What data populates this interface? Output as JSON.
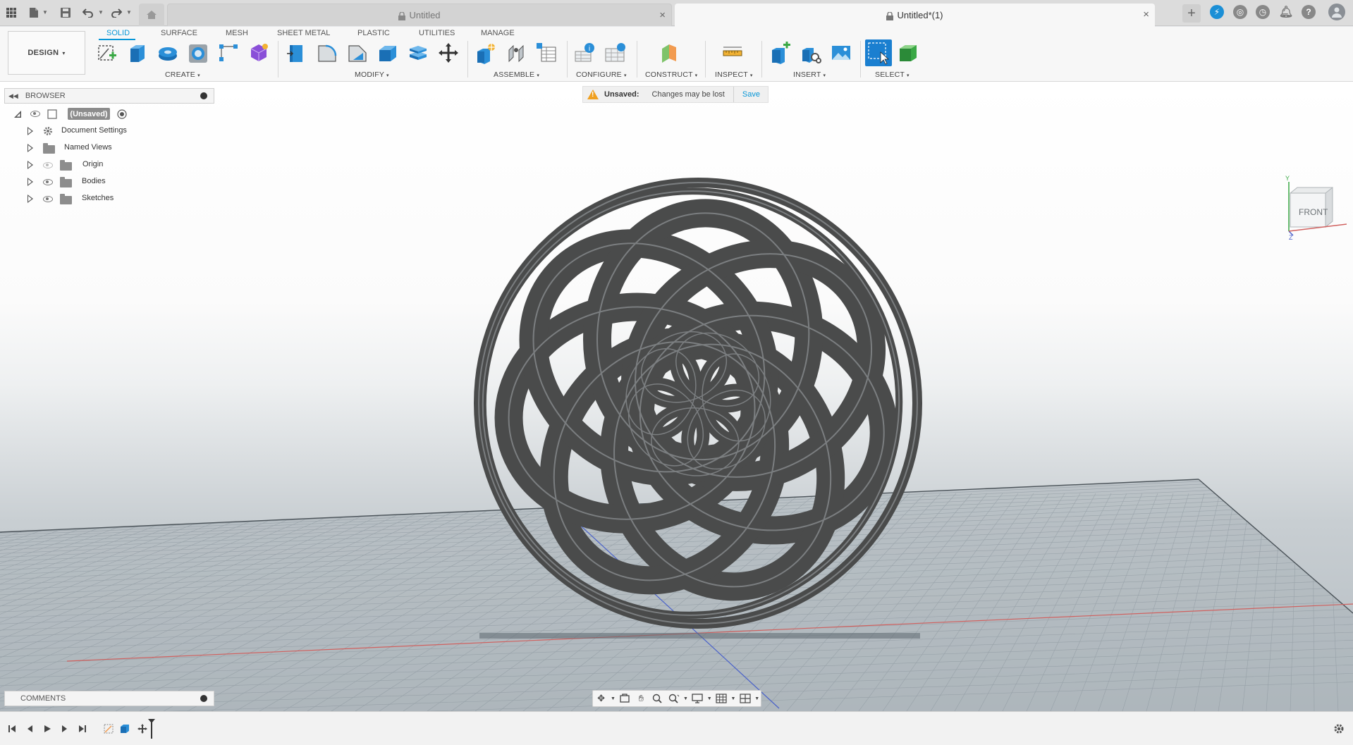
{
  "tabs": {
    "inactive": {
      "title": "Untitled"
    },
    "active": {
      "title": "Untitled*(1)"
    },
    "close_glyph": "×"
  },
  "ribbon": {
    "workspace": "DESIGN",
    "workspace_tabs": [
      "SOLID",
      "SURFACE",
      "MESH",
      "SHEET METAL",
      "PLASTIC",
      "UTILITIES",
      "MANAGE"
    ],
    "active_tab": "SOLID",
    "groups": {
      "create": "CREATE",
      "modify": "MODIFY",
      "assemble": "ASSEMBLE",
      "configure": "CONFIGURE",
      "construct": "CONSTRUCT",
      "inspect": "INSPECT",
      "insert": "INSERT",
      "select": "SELECT"
    },
    "caret": "▾"
  },
  "browser": {
    "title": "BROWSER",
    "root": {
      "label": "(Unsaved)"
    },
    "items": [
      {
        "label": "Document Settings",
        "icon": "gear-icon"
      },
      {
        "label": "Named Views",
        "icon": "folder-icon"
      },
      {
        "label": "Origin",
        "icon": "folder-icon",
        "visible": false
      },
      {
        "label": "Bodies",
        "icon": "folder-icon",
        "visible": true
      },
      {
        "label": "Sketches",
        "icon": "folder-icon",
        "visible": true
      }
    ]
  },
  "banner": {
    "title": "Unsaved:",
    "message": "Changes may be lost",
    "action": "Save"
  },
  "viewcube": {
    "face": "FRONT",
    "axis_y": "Y",
    "axis_z": "Z"
  },
  "comments": {
    "title": "COMMENTS"
  },
  "colors": {
    "accent": "#0696d7",
    "model": "#4a4b4b",
    "model_edge": "#7b7e80",
    "warning": "#f0a020"
  }
}
